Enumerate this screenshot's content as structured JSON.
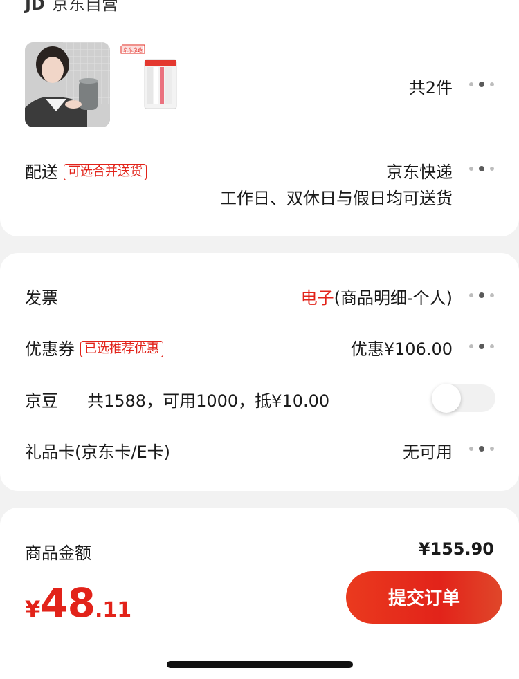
{
  "store": {
    "logo": "JD",
    "name": "京东自营"
  },
  "products": {
    "count_label": "共2件",
    "thumb_badge": "京东京造"
  },
  "delivery": {
    "label": "配送",
    "tag": "可选合并送货",
    "method": "京东快递",
    "schedule": "工作日、双休日与假日均可送货"
  },
  "invoice": {
    "label": "发票",
    "type": "电子",
    "detail": "(商品明细-个人)"
  },
  "coupon": {
    "label": "优惠券",
    "tag": "已选推荐优惠",
    "value": "优惠¥106.00"
  },
  "jingdou": {
    "label": "京豆",
    "info": "共1588，可用1000，抵¥10.00",
    "enabled": false
  },
  "gift_card": {
    "label": "礼品卡(京东卡/E卡)",
    "value": "无可用"
  },
  "amount": {
    "label": "商品金额",
    "value": "¥155.90"
  },
  "total": {
    "symbol": "¥",
    "integer": "48",
    "decimal": ".11"
  },
  "submit_label": "提交订单",
  "colors": {
    "accent": "#e2231a",
    "background": "#f2f2f2"
  }
}
